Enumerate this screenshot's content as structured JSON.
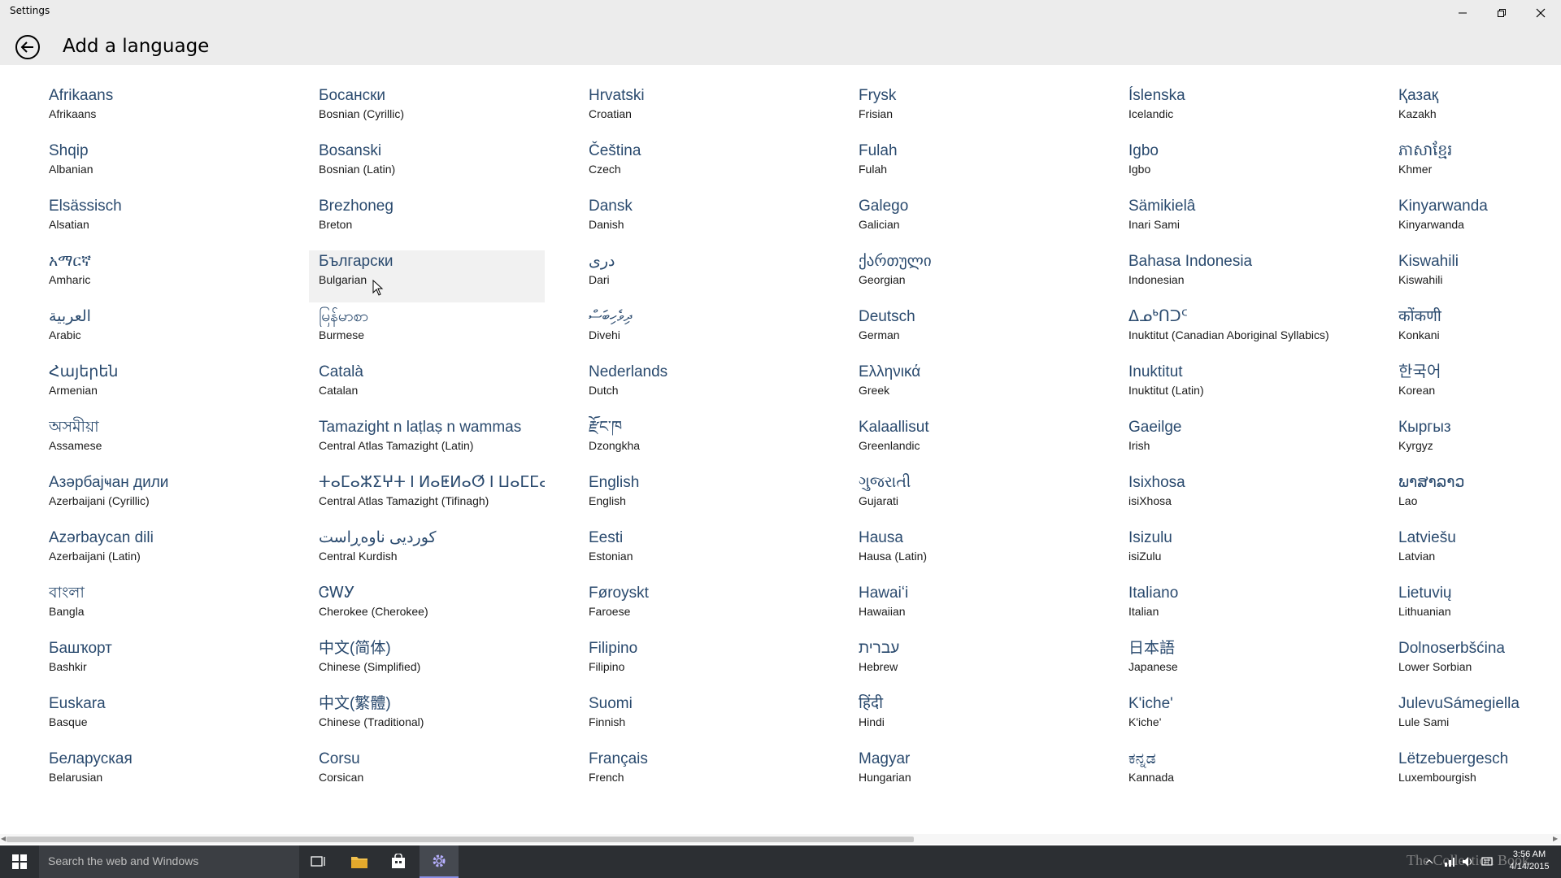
{
  "window": {
    "app_title": "Settings"
  },
  "header": {
    "page_title": "Add a language"
  },
  "languages": [
    {
      "native": "Afrikaans",
      "english": "Afrikaans"
    },
    {
      "native": "Shqip",
      "english": "Albanian"
    },
    {
      "native": "Elsässisch",
      "english": "Alsatian"
    },
    {
      "native": "አማርኛ",
      "english": "Amharic"
    },
    {
      "native": "العربية",
      "english": "Arabic"
    },
    {
      "native": "Հայերեն",
      "english": "Armenian"
    },
    {
      "native": "অসমীয়া",
      "english": "Assamese"
    },
    {
      "native": "Азәрбајҹан дили",
      "english": "Azerbaijani (Cyrillic)"
    },
    {
      "native": "Azərbaycan dili",
      "english": "Azerbaijani (Latin)"
    },
    {
      "native": "বাংলা",
      "english": "Bangla"
    },
    {
      "native": "Башҡорт",
      "english": "Bashkir"
    },
    {
      "native": "Euskara",
      "english": "Basque"
    },
    {
      "native": "Беларуская",
      "english": "Belarusian"
    },
    {
      "native": "Босански",
      "english": "Bosnian (Cyrillic)"
    },
    {
      "native": "Bosanski",
      "english": "Bosnian (Latin)"
    },
    {
      "native": "Brezhoneg",
      "english": "Breton"
    },
    {
      "native": "Български",
      "english": "Bulgarian"
    },
    {
      "native": "မြန်မာစာ",
      "english": "Burmese"
    },
    {
      "native": "Català",
      "english": "Catalan"
    },
    {
      "native": "Tamazight n laṭlaṣ n wammas",
      "english": "Central Atlas Tamazight (Latin)"
    },
    {
      "native": "ⵜⴰⵎⴰⵣⵉⵖⵜ ⵏ ⵍⴰⵟⵍⴰⵚ ⵏ ⵡⴰⵎⵎⴰⵙ",
      "english": "Central Atlas Tamazight (Tifinagh)"
    },
    {
      "native": "کوردیی ناوەڕاست",
      "english": "Central Kurdish"
    },
    {
      "native": "ᏣᎳᎩ",
      "english": "Cherokee (Cherokee)"
    },
    {
      "native": "中文(简体)",
      "english": "Chinese (Simplified)"
    },
    {
      "native": "中文(繁體)",
      "english": "Chinese (Traditional)"
    },
    {
      "native": "Corsu",
      "english": "Corsican"
    },
    {
      "native": "Hrvatski",
      "english": "Croatian"
    },
    {
      "native": "Čeština",
      "english": "Czech"
    },
    {
      "native": "Dansk",
      "english": "Danish"
    },
    {
      "native": "دری",
      "english": "Dari"
    },
    {
      "native": "ދިވެހިބަސް",
      "english": "Divehi"
    },
    {
      "native": "Nederlands",
      "english": "Dutch"
    },
    {
      "native": "རྫོང་ཁ",
      "english": "Dzongkha"
    },
    {
      "native": "English",
      "english": "English"
    },
    {
      "native": "Eesti",
      "english": "Estonian"
    },
    {
      "native": "Føroyskt",
      "english": "Faroese"
    },
    {
      "native": "Filipino",
      "english": "Filipino"
    },
    {
      "native": "Suomi",
      "english": "Finnish"
    },
    {
      "native": "Français",
      "english": "French"
    },
    {
      "native": "Frysk",
      "english": "Frisian"
    },
    {
      "native": "Fulah",
      "english": "Fulah"
    },
    {
      "native": "Galego",
      "english": "Galician"
    },
    {
      "native": "ქართული",
      "english": "Georgian"
    },
    {
      "native": "Deutsch",
      "english": "German"
    },
    {
      "native": "Ελληνικά",
      "english": "Greek"
    },
    {
      "native": "Kalaallisut",
      "english": "Greenlandic"
    },
    {
      "native": "ગુજરાતી",
      "english": "Gujarati"
    },
    {
      "native": "Hausa",
      "english": "Hausa (Latin)"
    },
    {
      "native": "Hawaiʻi",
      "english": "Hawaiian"
    },
    {
      "native": "עברית",
      "english": "Hebrew"
    },
    {
      "native": "हिंदी",
      "english": "Hindi"
    },
    {
      "native": "Magyar",
      "english": "Hungarian"
    },
    {
      "native": "Íslenska",
      "english": "Icelandic"
    },
    {
      "native": "Igbo",
      "english": "Igbo"
    },
    {
      "native": "Sämikielâ",
      "english": "Inari Sami"
    },
    {
      "native": "Bahasa Indonesia",
      "english": "Indonesian"
    },
    {
      "native": "ᐃᓄᒃᑎᑐᑦ",
      "english": "Inuktitut (Canadian Aboriginal Syllabics)"
    },
    {
      "native": "Inuktitut",
      "english": "Inuktitut (Latin)"
    },
    {
      "native": "Gaeilge",
      "english": "Irish"
    },
    {
      "native": "Isixhosa",
      "english": "isiXhosa"
    },
    {
      "native": "Isizulu",
      "english": "isiZulu"
    },
    {
      "native": "Italiano",
      "english": "Italian"
    },
    {
      "native": "日本語",
      "english": "Japanese"
    },
    {
      "native": "K'iche'",
      "english": "K'iche'"
    },
    {
      "native": "ಕನ್ನಡ",
      "english": "Kannada"
    },
    {
      "native": "Қазақ",
      "english": "Kazakh"
    },
    {
      "native": "ភាសាខ្មែរ",
      "english": "Khmer"
    },
    {
      "native": "Kinyarwanda",
      "english": "Kinyarwanda"
    },
    {
      "native": "Kiswahili",
      "english": "Kiswahili"
    },
    {
      "native": "कोंकणी",
      "english": "Konkani"
    },
    {
      "native": "한국어",
      "english": "Korean"
    },
    {
      "native": "Кыргыз",
      "english": "Kyrgyz"
    },
    {
      "native": "ພາສາລາວ",
      "english": "Lao"
    },
    {
      "native": "Latviešu",
      "english": "Latvian"
    },
    {
      "native": "Lietuvių",
      "english": "Lithuanian"
    },
    {
      "native": "Dolnoserbšćina",
      "english": "Lower Sorbian"
    },
    {
      "native": "JulevuSámegiella",
      "english": "Lule Sami"
    },
    {
      "native": "Lëtzebuergesch",
      "english": "Luxembourgish"
    }
  ],
  "hover_index": 16,
  "taskbar": {
    "search_placeholder": "Search the web and Windows",
    "clock_time": "3:56 AM",
    "clock_date": "4/14/2015",
    "watermark": "The Collection Book"
  },
  "icons": {
    "back": "back-arrow-icon",
    "minimize": "minimize-icon",
    "maximize": "restore-icon",
    "close": "close-icon",
    "start": "windows-logo-icon",
    "task_view": "task-view-icon",
    "file_explorer": "folder-icon",
    "store": "store-icon",
    "settings": "gear-icon"
  },
  "colors": {
    "titlebar_bg": "#ececec",
    "native_text": "#2a4a6e",
    "taskbar_bg": "#2c2f33",
    "hover_bg": "#f1f1f1"
  }
}
